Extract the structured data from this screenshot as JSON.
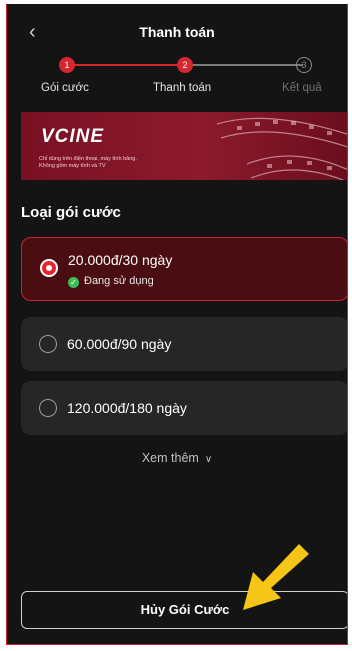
{
  "header": {
    "back_icon": "chevron-left-icon",
    "title": "Thanh toán"
  },
  "stepper": {
    "steps": [
      {
        "number": "1",
        "label": "Gói cước",
        "state": "done"
      },
      {
        "number": "2",
        "label": "Thanh toán",
        "state": "active"
      },
      {
        "number": "3",
        "label": "Kết quả",
        "state": "pending"
      }
    ]
  },
  "banner": {
    "logo": "VCINE",
    "text_line1": "Chỉ dùng trên điện thoại, máy tính bảng.",
    "text_line2": "Không gồm máy tính và TV"
  },
  "plans": {
    "section_title": "Loại gói cước",
    "options": [
      {
        "label": "20.000đ/30 ngày",
        "selected": true,
        "status": "Đang sử dụng"
      },
      {
        "label": "60.000đ/90 ngày",
        "selected": false
      },
      {
        "label": "120.000đ/180 ngày",
        "selected": false
      }
    ],
    "more_label": "Xem thêm"
  },
  "actions": {
    "cancel_label": "Hủy Gói Cước"
  },
  "colors": {
    "accent": "#d7262f",
    "background": "#141414",
    "selected_bg": "#4a0d11",
    "arrow": "#f5c518"
  }
}
